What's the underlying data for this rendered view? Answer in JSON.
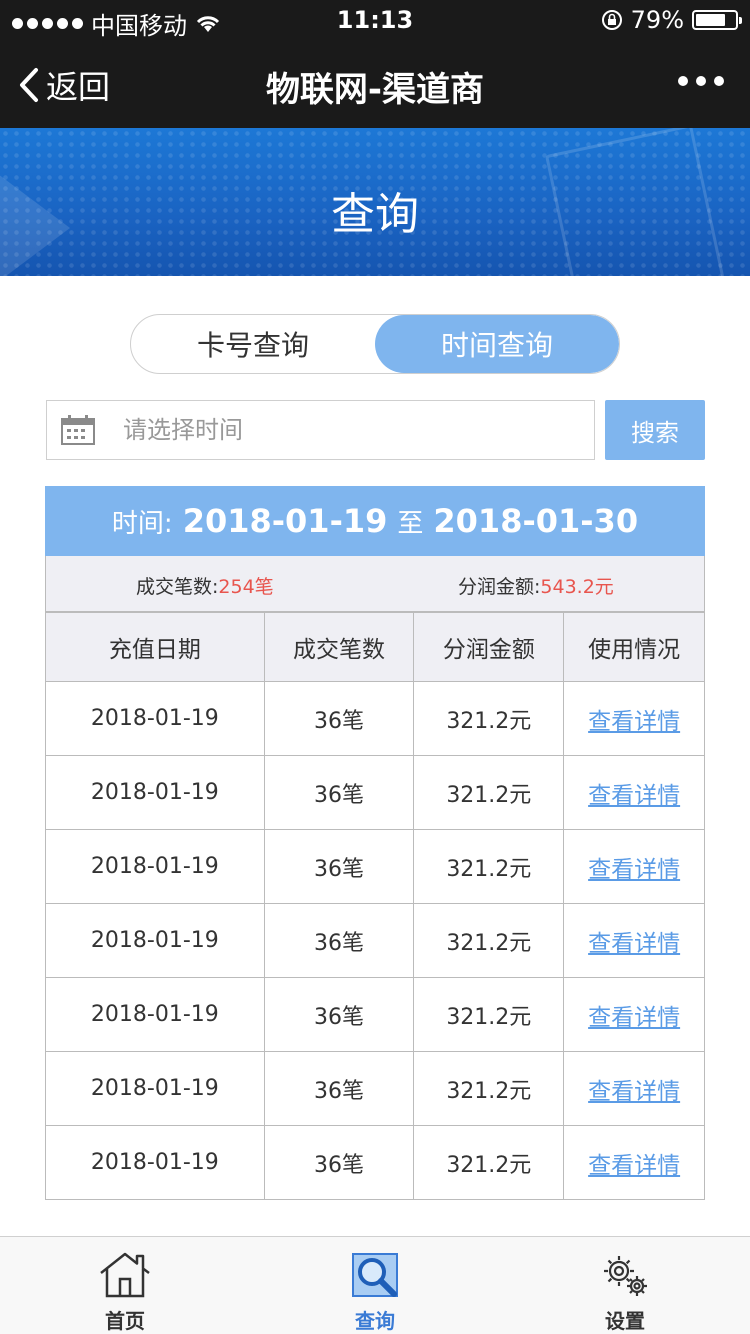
{
  "status_bar": {
    "carrier": "中国移动",
    "time": "11:13",
    "battery_percent_text": "79%",
    "battery_level": 0.79
  },
  "nav": {
    "back_label": "返回",
    "title": "物联网-渠道商"
  },
  "banner": {
    "title": "查询"
  },
  "segment": {
    "tabs": [
      {
        "label": "卡号查询",
        "active": false
      },
      {
        "label": "时间查询",
        "active": true
      }
    ]
  },
  "search": {
    "placeholder": "请选择时间",
    "button_label": "搜索"
  },
  "range": {
    "label": "时间:",
    "start": "2018-01-19",
    "separator": "至",
    "end": "2018-01-30"
  },
  "summary": {
    "count_label": "成交笔数:",
    "count_value": "254笔",
    "amount_label": "分润金额:",
    "amount_value": "543.2元"
  },
  "table": {
    "headers": [
      "充值日期",
      "成交笔数",
      "分润金额",
      "使用情况"
    ],
    "rows": [
      {
        "date": "2018-01-19",
        "count": "36笔",
        "amount": "321.2元",
        "link": "查看详情"
      },
      {
        "date": "2018-01-19",
        "count": "36笔",
        "amount": "321.2元",
        "link": "查看详情"
      },
      {
        "date": "2018-01-19",
        "count": "36笔",
        "amount": "321.2元",
        "link": "查看详情"
      },
      {
        "date": "2018-01-19",
        "count": "36笔",
        "amount": "321.2元",
        "link": "查看详情"
      },
      {
        "date": "2018-01-19",
        "count": "36笔",
        "amount": "321.2元",
        "link": "查看详情"
      },
      {
        "date": "2018-01-19",
        "count": "36笔",
        "amount": "321.2元",
        "link": "查看详情"
      },
      {
        "date": "2018-01-19",
        "count": "36笔",
        "amount": "321.2元",
        "link": "查看详情"
      }
    ]
  },
  "tabbar": {
    "items": [
      {
        "label": "首页",
        "icon": "home-icon",
        "active": false
      },
      {
        "label": "查询",
        "icon": "search-icon",
        "active": true
      },
      {
        "label": "设置",
        "icon": "gear-icon",
        "active": false
      }
    ]
  },
  "colors": {
    "accent": "#7fb5ee",
    "highlight_red": "#e8554e",
    "link_blue": "#5a9be6",
    "active_tab": "#3a7bd5"
  }
}
